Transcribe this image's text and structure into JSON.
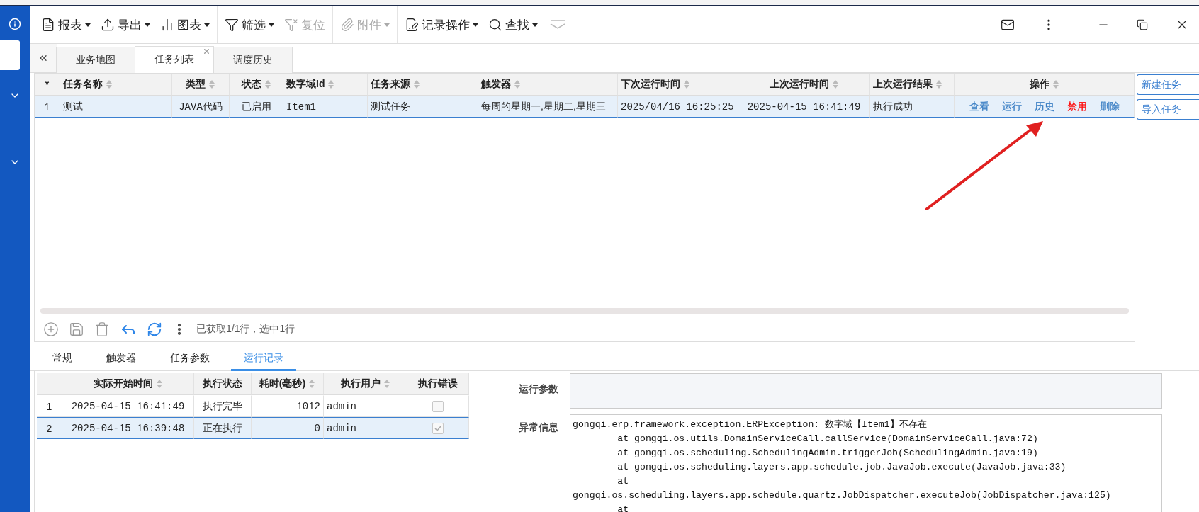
{
  "toolbar": {
    "groups": [
      [
        {
          "label": "报表",
          "dropdown": true,
          "disabled": false
        },
        {
          "label": "导出",
          "dropdown": true,
          "disabled": false
        },
        {
          "label": "图表",
          "dropdown": true,
          "disabled": false
        }
      ],
      [
        {
          "label": "筛选",
          "dropdown": true,
          "disabled": false
        },
        {
          "label": "复位",
          "dropdown": false,
          "disabled": true
        }
      ],
      [
        {
          "label": "附件",
          "dropdown": true,
          "disabled": true
        }
      ],
      [
        {
          "label": "记录操作",
          "dropdown": true,
          "disabled": false
        },
        {
          "label": "查找",
          "dropdown": true,
          "disabled": false
        }
      ]
    ]
  },
  "tabs": [
    {
      "label": "业务地图",
      "selected": false,
      "closable": false
    },
    {
      "label": "任务列表",
      "selected": true,
      "closable": true
    },
    {
      "label": "调度历史",
      "selected": false,
      "closable": false
    }
  ],
  "task_table": {
    "columns": [
      {
        "label": "*",
        "sortable": false
      },
      {
        "label": "任务名称",
        "sortable": true
      },
      {
        "label": "类型",
        "sortable": true
      },
      {
        "label": "状态",
        "sortable": true
      },
      {
        "label": "数字域Id",
        "sortable": true
      },
      {
        "label": "任务来源",
        "sortable": true
      },
      {
        "label": "触发器",
        "sortable": true
      },
      {
        "label": "下次运行时间",
        "sortable": true
      },
      {
        "label": "上次运行时间",
        "sortable": true
      },
      {
        "label": "上次运行结果",
        "sortable": true
      },
      {
        "label": "操作",
        "sortable": true
      }
    ],
    "rows": [
      {
        "selected": true,
        "cells": [
          "1",
          "测试",
          "JAVA代码",
          "已启用",
          "Item1",
          "测试任务",
          "每周的星期一,星期二,星期三",
          "2025/04/16 16:25:25",
          "2025-04-15 16:41:49",
          "执行成功"
        ],
        "actions": [
          {
            "label": "查看",
            "color": "#3b7fc4"
          },
          {
            "label": "运行",
            "color": "#3b7fc4"
          },
          {
            "label": "历史",
            "color": "#3b7fc4"
          },
          {
            "label": "禁用",
            "color": "#ff0000"
          },
          {
            "label": "删除",
            "color": "#3b7fc4"
          }
        ]
      }
    ],
    "status": "已获取1/1行，选中1行"
  },
  "side_buttons": [
    "新建任务",
    "导入任务"
  ],
  "detail_tabs": [
    {
      "label": "常规",
      "selected": false
    },
    {
      "label": "触发器",
      "selected": false
    },
    {
      "label": "任务参数",
      "selected": false
    },
    {
      "label": "运行记录",
      "selected": true
    }
  ],
  "run_table": {
    "columns": [
      {
        "label": "实际开始时间",
        "sortable": true
      },
      {
        "label": "执行状态",
        "sortable": false
      },
      {
        "label": "耗时(毫秒)",
        "sortable": true
      },
      {
        "label": "执行用户",
        "sortable": true
      },
      {
        "label": "执行错误",
        "sortable": false
      }
    ],
    "rows": [
      {
        "index": "1",
        "start": "2025-04-15 16:41:49",
        "state": "执行完毕",
        "duration": "1012",
        "user": "admin",
        "error": false,
        "selected": false
      },
      {
        "index": "2",
        "start": "2025-04-15 16:39:48",
        "state": "正在执行",
        "duration": "0",
        "user": "admin",
        "error": true,
        "selected": true
      }
    ]
  },
  "fields": [
    {
      "label": "运行参数",
      "kind": "input"
    },
    {
      "label": "异常信息",
      "kind": "textarea",
      "value": "gongqi.erp.framework.exception.ERPException: 数字域【Item1】不存在\n        at gongqi.os.utils.DomainServiceCall.callService(DomainServiceCall.java:72)\n        at gongqi.os.scheduling.SchedulingAdmin.triggerJob(SchedulingAdmin.java:19)\n        at gongqi.os.scheduling.layers.app.schedule.job.JavaJob.execute(JavaJob.java:33)\n        at\ngongqi.os.scheduling.layers.app.schedule.quartz.JobDispatcher.executeJob(JobDispatcher.java:125)\n        at"
    }
  ]
}
